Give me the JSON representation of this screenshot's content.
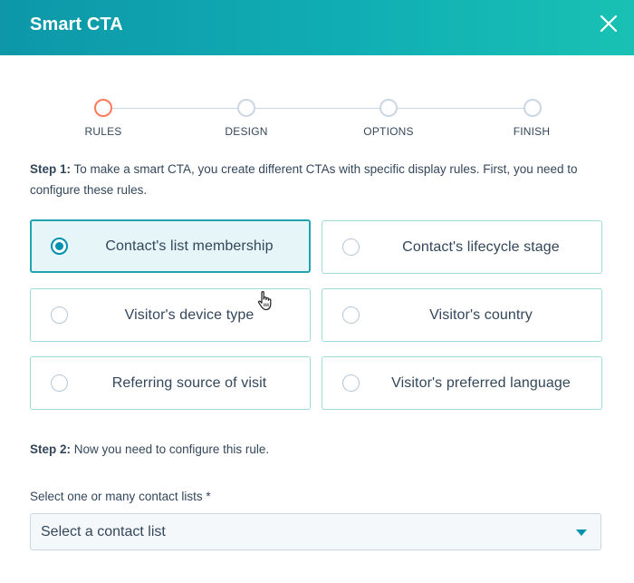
{
  "dialog": {
    "title": "Smart CTA",
    "close_icon": "close-icon"
  },
  "stepper": {
    "steps": [
      {
        "label": "RULES",
        "active": true
      },
      {
        "label": "DESIGN",
        "active": false
      },
      {
        "label": "OPTIONS",
        "active": false
      },
      {
        "label": "FINISH",
        "active": false
      }
    ]
  },
  "step1": {
    "prefix": "Step 1:",
    "text": "To make a smart CTA, you create different CTAs with specific display rules. First, you need to configure these rules."
  },
  "rules": [
    {
      "label": "Contact's list membership",
      "selected": true
    },
    {
      "label": "Contact's lifecycle stage",
      "selected": false
    },
    {
      "label": "Visitor's device type",
      "selected": false
    },
    {
      "label": "Visitor's country",
      "selected": false
    },
    {
      "label": "Referring source of visit",
      "selected": false
    },
    {
      "label": "Visitor's preferred language",
      "selected": false
    }
  ],
  "step2": {
    "prefix": "Step 2:",
    "text": "Now you need to configure this rule."
  },
  "contact_lists": {
    "label": "Select one or many contact lists *",
    "placeholder": "Select a contact list"
  },
  "colors": {
    "header_gradient_start": "#0d97a8",
    "header_gradient_end": "#19c1b3",
    "active_step": "#ff7a59",
    "selected_accent": "#0091ae",
    "card_border": "#9fdadd"
  }
}
